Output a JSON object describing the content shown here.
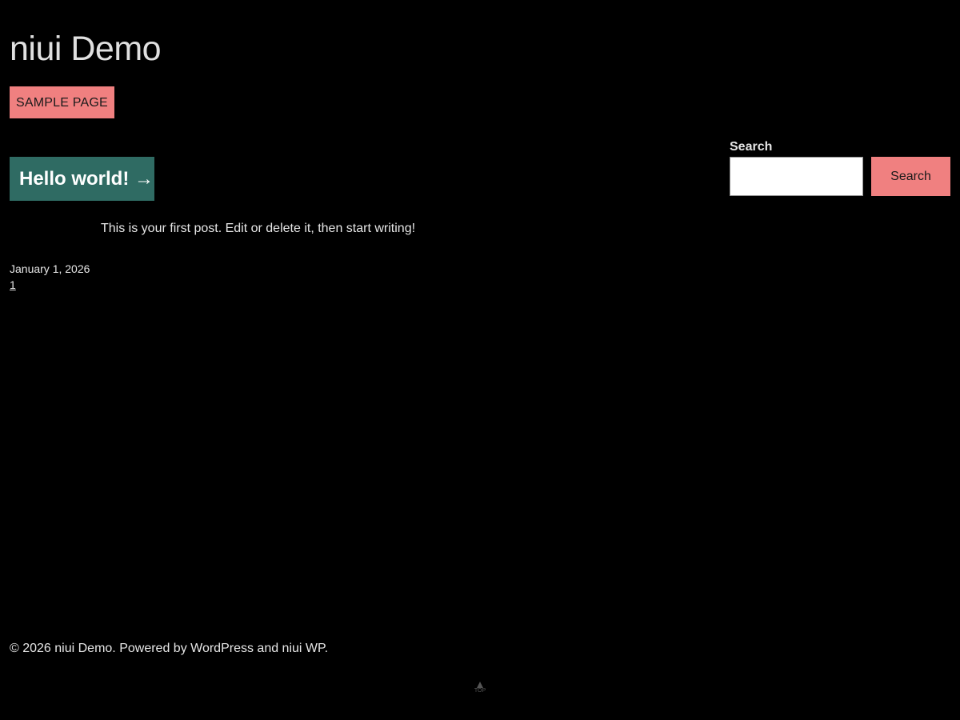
{
  "site": {
    "title": "niui Demo"
  },
  "nav": {
    "items": [
      {
        "label": "SAMPLE PAGE"
      }
    ]
  },
  "post": {
    "title": "Hello world! →",
    "excerpt": "This is your first post. Edit or delete it, then start writing!",
    "date": "January 1, 2026"
  },
  "pagination": {
    "current": "1"
  },
  "search": {
    "label": "Search",
    "placeholder": "",
    "value": "",
    "button_label": "Search"
  },
  "footer": {
    "text": "© 2026 niui Demo. Powered by WordPress and niui WP.",
    "top_label": "TOP"
  },
  "colors": {
    "background": "#000000",
    "accent": "#f08080",
    "post_title_bg": "#2f6b63"
  }
}
